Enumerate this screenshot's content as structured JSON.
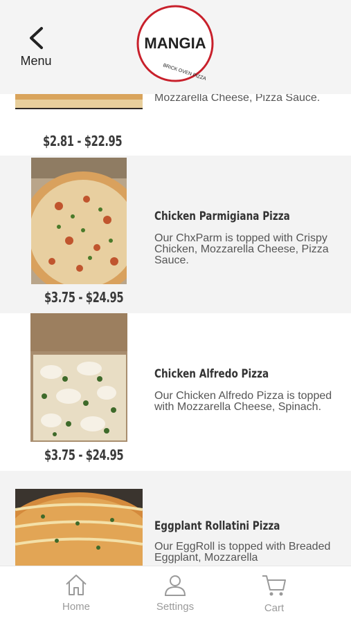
{
  "header": {
    "back_label": "Menu",
    "logo_text": "MANGIA",
    "logo_subtext": "BRICK OVEN PIZZA"
  },
  "items": [
    {
      "price": "$2.81 - $22.95",
      "desc": "Mozzarella Cheese, Pizza Sauce."
    },
    {
      "title": "Chicken Parmigiana Pizza",
      "desc": "Our ChxParm is topped with Crispy Chicken, Mozzarella Cheese, Pizza Sauce.",
      "price": "$3.75 - $24.95"
    },
    {
      "title": "Chicken Alfredo Pizza",
      "desc": "Our Chicken Alfredo Pizza is topped with Mozzarella Cheese, Spinach.",
      "price": "$3.75 - $24.95"
    },
    {
      "title": "Eggplant Rollatini Pizza",
      "desc": "Our EggRoll is topped with Breaded Eggplant, Mozzarella"
    }
  ],
  "tabbar": {
    "home": "Home",
    "settings": "Settings",
    "cart": "Cart"
  },
  "colors": {
    "brand_red": "#c8202b",
    "tab_gray": "#9a9a9a"
  }
}
